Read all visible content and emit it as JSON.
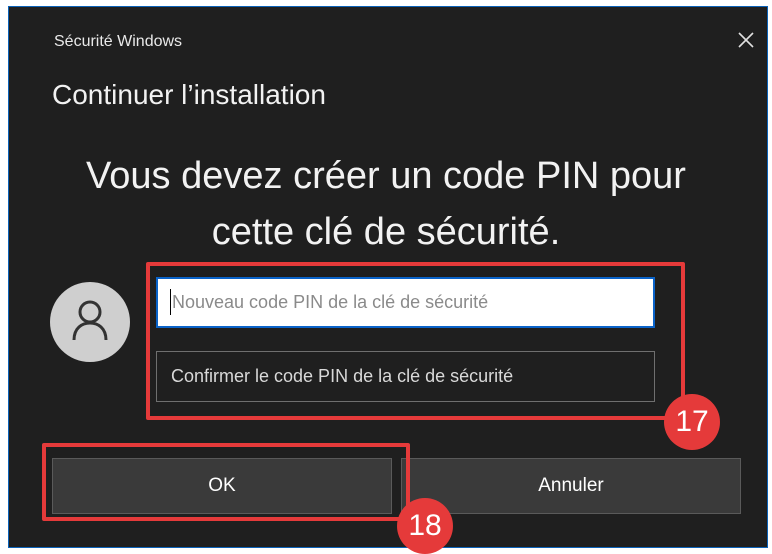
{
  "window": {
    "app_title": "Sécurité Windows",
    "close_icon": "close-icon"
  },
  "dialog": {
    "heading": "Continuer l’installation",
    "message_line1": "Vous devez créer un code PIN pour",
    "message_line2": "cette clé de sécurité.",
    "avatar_icon": "user-icon"
  },
  "fields": {
    "new_pin_placeholder": "Nouveau code PIN de la clé de sécurité",
    "new_pin_value": "",
    "confirm_pin_placeholder": "Confirmer le code PIN de la clé de sécurité",
    "confirm_pin_value": ""
  },
  "buttons": {
    "ok_label": "OK",
    "cancel_label": "Annuler"
  },
  "annotations": {
    "badge_inputs": "17",
    "badge_ok": "18",
    "highlight_color": "#e53a3a"
  },
  "colors": {
    "dialog_bg": "#1f1f1f",
    "accent": "#0a63c9"
  }
}
